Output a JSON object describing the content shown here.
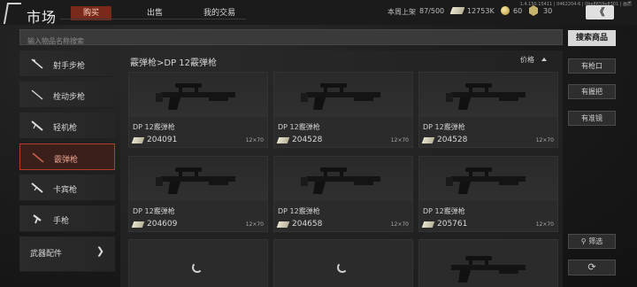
{
  "header": {
    "title": "市场",
    "tabs": [
      {
        "label": "购买",
        "active": true
      },
      {
        "label": "出售",
        "active": false
      },
      {
        "label": "我的交易",
        "active": false
      }
    ],
    "listing_label": "本周上架",
    "listing_count": "87/500",
    "money": "12753K",
    "coins": "60",
    "badges": "30",
    "version": "1.4.150.15411 | 0462204-6 | 0ba8659e8301 | 画质",
    "collapse_label": "《"
  },
  "search": {
    "placeholder": "输入物品名称搜索",
    "button_label": "搜索商品"
  },
  "sidebar": {
    "items": [
      {
        "label": "射手步枪",
        "icon": "rifle-icon",
        "active": false
      },
      {
        "label": "栓动步枪",
        "icon": "bolt-rifle-icon",
        "active": false
      },
      {
        "label": "轻机枪",
        "icon": "lmg-icon",
        "active": false
      },
      {
        "label": "霰弹枪",
        "icon": "shotgun-icon",
        "active": true
      },
      {
        "label": "卡宾枪",
        "icon": "carbine-icon",
        "active": false
      },
      {
        "label": "手枪",
        "icon": "pistol-icon",
        "active": false
      }
    ],
    "accessories_label": "武器配件",
    "accessories_arrow": "❯"
  },
  "main": {
    "breadcrumb": "霰弹枪>DP 12霰弹枪",
    "sort_label": "价格",
    "items": [
      {
        "name": "DP 12霰弹枪",
        "price": "204091",
        "ammo": "12×70"
      },
      {
        "name": "DP 12霰弹枪",
        "price": "204528",
        "ammo": "12×70"
      },
      {
        "name": "DP 12霰弹枪",
        "price": "204528",
        "ammo": "12×70"
      },
      {
        "name": "DP 12霰弹枪",
        "price": "204609",
        "ammo": "12×70"
      },
      {
        "name": "DP 12霰弹枪",
        "price": "204658",
        "ammo": "12×70"
      },
      {
        "name": "DP 12霰弹枪",
        "price": "205761",
        "ammo": "12×70"
      }
    ]
  },
  "right_panel": {
    "attachments": [
      "有枪口",
      "有握把",
      "有准镜"
    ],
    "filter_label": "筛选",
    "refresh_label": "⟳"
  },
  "colors": {
    "accent": "#b0402a",
    "tab_active": "#7a2a1a"
  }
}
